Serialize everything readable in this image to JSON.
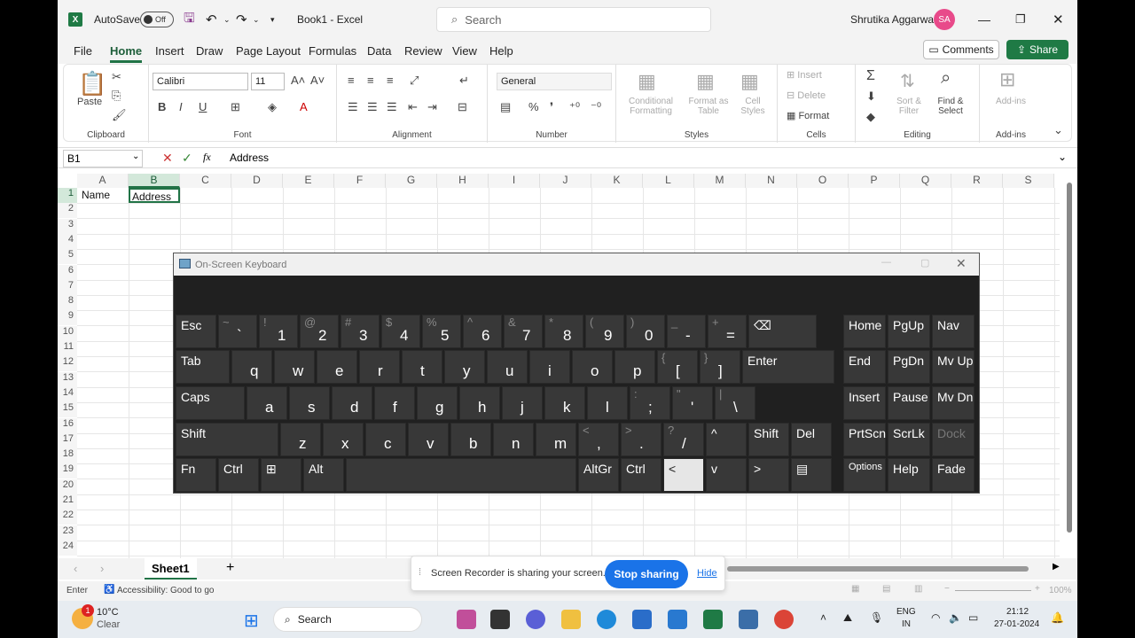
{
  "title_bar": {
    "autosave_label": "AutoSave",
    "autosave_state": "Off",
    "doc_title": "Book1 - Excel",
    "search_placeholder": "Search",
    "user_name": "Shrutika Aggarwal",
    "user_initials": "SA"
  },
  "menu": [
    "File",
    "Home",
    "Insert",
    "Draw",
    "Page Layout",
    "Formulas",
    "Data",
    "Review",
    "View",
    "Help"
  ],
  "comments_label": "Comments",
  "share_label": "Share",
  "ribbon": {
    "clipboard": {
      "paste": "Paste",
      "label": "Clipboard"
    },
    "font": {
      "name": "Calibri",
      "size": "11",
      "label": "Font"
    },
    "alignment": {
      "label": "Alignment"
    },
    "number": {
      "format": "General",
      "label": "Number"
    },
    "styles": {
      "conditional": "Conditional Formatting",
      "format_table": "Format as Table",
      "cell_styles": "Cell Styles",
      "label": "Styles"
    },
    "cells": {
      "insert": "Insert",
      "delete": "Delete",
      "format": "Format",
      "label": "Cells"
    },
    "editing": {
      "sort": "Sort & Filter",
      "find": "Find & Select",
      "label": "Editing"
    },
    "addins": {
      "btn": "Add-ins",
      "label": "Add-ins"
    }
  },
  "formula_bar": {
    "name_box": "B1",
    "fx": "fx",
    "content": "Address"
  },
  "columns": [
    "A",
    "B",
    "C",
    "D",
    "E",
    "F",
    "G",
    "H",
    "I",
    "J",
    "K",
    "L",
    "M",
    "N",
    "O",
    "P",
    "Q",
    "R",
    "S"
  ],
  "rows": [
    "1",
    "2",
    "3",
    "4",
    "5",
    "6",
    "7",
    "8",
    "9",
    "10",
    "11",
    "12",
    "13",
    "14",
    "15",
    "16",
    "17",
    "18",
    "19",
    "20",
    "21",
    "22",
    "23",
    "24"
  ],
  "cells": {
    "A1": "Name",
    "B1": "Address"
  },
  "osk": {
    "title": "On-Screen Keyboard",
    "row1": [
      {
        "l": "Esc"
      },
      {
        "s": "~",
        "b": "`"
      },
      {
        "s": "!",
        "b": "1"
      },
      {
        "s": "@",
        "b": "2"
      },
      {
        "s": "#",
        "b": "3"
      },
      {
        "s": "$",
        "b": "4"
      },
      {
        "s": "%",
        "b": "5"
      },
      {
        "s": "^",
        "b": "6"
      },
      {
        "s": "&",
        "b": "7"
      },
      {
        "s": "*",
        "b": "8"
      },
      {
        "s": "(",
        "b": "9"
      },
      {
        "s": ")",
        "b": "0"
      },
      {
        "s": "_",
        "b": "-"
      },
      {
        "s": "+",
        "b": "="
      },
      {
        "l": "⌫"
      }
    ],
    "row2": [
      {
        "l": "Tab"
      },
      {
        "b": "q"
      },
      {
        "b": "w"
      },
      {
        "b": "e"
      },
      {
        "b": "r"
      },
      {
        "b": "t"
      },
      {
        "b": "y"
      },
      {
        "b": "u"
      },
      {
        "b": "i"
      },
      {
        "b": "o"
      },
      {
        "b": "p"
      },
      {
        "s": "{",
        "b": "["
      },
      {
        "s": "}",
        "b": "]"
      },
      {
        "l": "Enter"
      }
    ],
    "row3": [
      {
        "l": "Caps"
      },
      {
        "b": "a"
      },
      {
        "b": "s"
      },
      {
        "b": "d"
      },
      {
        "b": "f"
      },
      {
        "b": "g"
      },
      {
        "b": "h"
      },
      {
        "b": "j"
      },
      {
        "b": "k"
      },
      {
        "b": "l"
      },
      {
        "s": ":",
        "b": ";"
      },
      {
        "s": "\"",
        "b": "'"
      },
      {
        "s": "|",
        "b": "\\"
      }
    ],
    "row4": [
      {
        "l": "Shift"
      },
      {
        "b": "z"
      },
      {
        "b": "x"
      },
      {
        "b": "c"
      },
      {
        "b": "v"
      },
      {
        "b": "b"
      },
      {
        "b": "n"
      },
      {
        "b": "m"
      },
      {
        "s": "<",
        "b": ","
      },
      {
        "s": ">",
        "b": "."
      },
      {
        "s": "?",
        "b": "/"
      },
      {
        "l": "^"
      },
      {
        "l": "Shift"
      },
      {
        "l": "Del"
      }
    ],
    "row5": [
      {
        "l": "Fn"
      },
      {
        "l": "Ctrl"
      },
      {
        "l": "⊞"
      },
      {
        "l": "Alt"
      },
      {
        "l": ""
      },
      {
        "l": "AltGr"
      },
      {
        "l": "Ctrl"
      },
      {
        "l": "<"
      },
      {
        "l": "v"
      },
      {
        "l": ">"
      },
      {
        "l": "▤"
      }
    ],
    "nav": [
      [
        "Home",
        "PgUp",
        "Nav"
      ],
      [
        "End",
        "PgDn",
        "Mv Up"
      ],
      [
        "Insert",
        "Pause",
        "Mv Dn"
      ],
      [
        "PrtScn",
        "ScrLk",
        "Dock"
      ],
      [
        "Options",
        "Help",
        "Fade"
      ]
    ]
  },
  "sheet": {
    "tab": "Sheet1"
  },
  "status": {
    "mode": "Enter",
    "accessibility": "Accessibility: Good to go",
    "zoom": "100%"
  },
  "share_notice": {
    "text": "Screen Recorder is sharing your screen.",
    "stop": "Stop sharing",
    "hide": "Hide"
  },
  "taskbar": {
    "weather_temp": "10°C",
    "weather_desc": "Clear",
    "weather_badge": "1",
    "search": "Search",
    "lang": "ENG",
    "region": "IN",
    "time": "21:12",
    "date": "27-01-2024"
  }
}
